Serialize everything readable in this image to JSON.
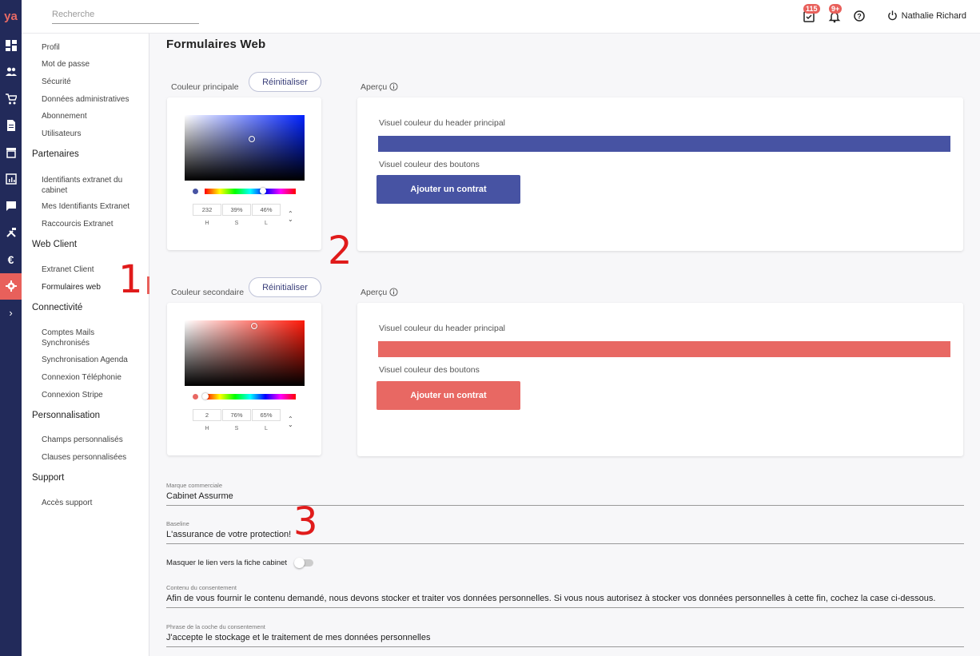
{
  "app": {
    "logo_text": "ya"
  },
  "rail_icons": [
    "dashboard-icon",
    "users-icon",
    "cart-icon",
    "document-icon",
    "store-icon",
    "report-icon",
    "message-icon",
    "tools-icon",
    "euro-icon",
    "settings-icon",
    "chevron-right-icon"
  ],
  "topbar": {
    "search_placeholder": "Recherche",
    "tasks_badge": "115",
    "notifications_badge": "9+",
    "user_name": "Nathalie Richard"
  },
  "sidebar": {
    "compte": [
      "Profil",
      "Mot de passe",
      "Sécurité",
      "Données administratives",
      "Abonnement",
      "Utilisateurs"
    ],
    "partenaires_head": "Partenaires",
    "partenaires": [
      "Identifiants extranet du cabinet",
      "Mes Identifiants Extranet",
      "Raccourcis Extranet"
    ],
    "webclient_head": "Web Client",
    "webclient": [
      "Extranet Client",
      "Formulaires web"
    ],
    "connectivite_head": "Connectivité",
    "connectivite": [
      "Comptes Mails Synchronisés",
      "Synchronisation Agenda",
      "Connexion Téléphonie",
      "Connexion Stripe"
    ],
    "perso_head": "Personnalisation",
    "perso": [
      "Champs personnalisés",
      "Clauses personnalisées"
    ],
    "support_head": "Support",
    "support": [
      "Accès support"
    ]
  },
  "main": {
    "title": "Formulaires Web",
    "primary": {
      "label": "Couleur principale",
      "reset": "Réinitialiser",
      "preview_label": "Aperçu",
      "header_text": "Visuel couleur du header principal",
      "buttons_text": "Visuel couleur des boutons",
      "button_label": "Ajouter un contrat",
      "color": "#4753a3",
      "hue_color": "#0022ff",
      "h": "232",
      "s": "39%",
      "l": "46%",
      "h_label": "H",
      "s_label": "S",
      "l_label": "L",
      "hue_fraction": 0.64
    },
    "secondary": {
      "label": "Couleur secondaire",
      "reset": "Réinitialiser",
      "preview_label": "Aperçu",
      "header_text": "Visuel couleur du header principal",
      "buttons_text": "Visuel couleur des boutons",
      "button_label": "Ajouter un contrat",
      "color": "#e86863",
      "hue_color": "#ff1a0a",
      "h": "2",
      "s": "76%",
      "l": "65%",
      "h_label": "H",
      "s_label": "S",
      "l_label": "L",
      "hue_fraction": 0.01
    },
    "marque_label": "Marque commerciale",
    "marque_value": "Cabinet Assurme",
    "baseline_label": "Baseline",
    "baseline_value": "L'assurance de votre protection!",
    "masquer_label": "Masquer le lien vers la fiche cabinet",
    "consent_label": "Contenu du consentement",
    "consent_value": "Afin de vous fournir le contenu demandé, nous devons stocker et traiter vos données personnelles. Si vous nous autorisez à stocker vos données personnelles à cette fin, cochez la case ci-dessous.",
    "phrase_label": "Phrase de la coche du consentement",
    "phrase_value": "J'accepte le stockage et le traitement de mes données personnelles"
  },
  "annotations": {
    "a1": "1",
    "a2": "2",
    "a3": "3"
  }
}
